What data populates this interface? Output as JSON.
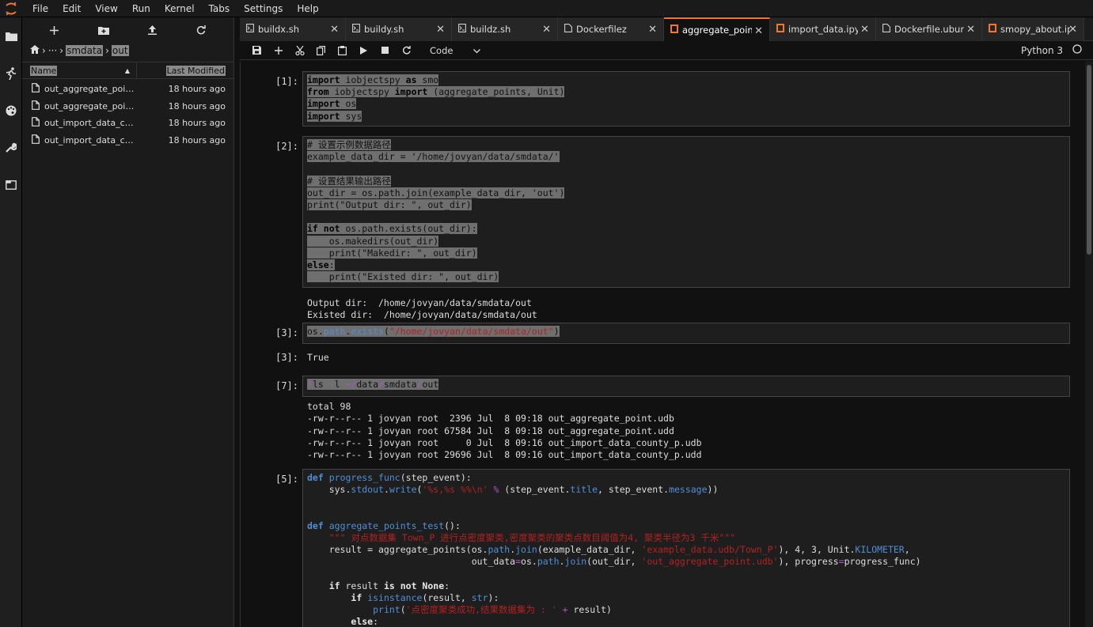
{
  "menubar": {
    "items": [
      "File",
      "Edit",
      "View",
      "Run",
      "Kernel",
      "Tabs",
      "Settings",
      "Help"
    ]
  },
  "filebrowser": {
    "breadcrumb": {
      "root_icon": "home-icon",
      "ellipsis": "···",
      "dir1": "smdata",
      "dir2": "out"
    },
    "columns": {
      "name": "Name",
      "modified": "Last Modified"
    },
    "files": [
      {
        "name": "out_aggregate_point.udb",
        "modified": "18 hours ago"
      },
      {
        "name": "out_aggregate_point.udd",
        "modified": "18 hours ago"
      },
      {
        "name": "out_import_data_county_p.udb",
        "modified": "18 hours ago"
      },
      {
        "name": "out_import_data_county_p.udd",
        "modified": "18 hours ago"
      }
    ]
  },
  "tabs": [
    {
      "label": "buildx.sh",
      "icon": "file-icon",
      "active": false
    },
    {
      "label": "buildy.sh",
      "icon": "file-icon",
      "active": false
    },
    {
      "label": "buildz.sh",
      "icon": "file-icon",
      "active": false
    },
    {
      "label": "Dockerfilez",
      "icon": "file-icon",
      "active": false
    },
    {
      "label": "aggregate_points",
      "icon": "notebook-icon",
      "active": true
    },
    {
      "label": "import_data.ipynb",
      "icon": "notebook-icon",
      "active": false
    },
    {
      "label": "Dockerfile.ubuntu",
      "icon": "file-icon",
      "active": false
    },
    {
      "label": "smopy_about.ipy",
      "icon": "notebook-icon",
      "active": false
    }
  ],
  "toolbar": {
    "cell_type": "Code",
    "kernel": "Python 3"
  },
  "cells": {
    "c1": {
      "prompt": "[1]:"
    },
    "c2": {
      "prompt": "[2]:",
      "out_prompt": "",
      "output": "Output dir:  /home/jovyan/data/smdata/out\nExisted dir:  /home/jovyan/data/smdata/out"
    },
    "c3": {
      "prompt": "[3]:",
      "out_prompt": "[3]:",
      "output": "True"
    },
    "c7": {
      "prompt": "[7]:",
      "output": "total 98\n-rw-r--r-- 1 jovyan root  2396 Jul  8 09:18 out_aggregate_point.udb\n-rw-r--r-- 1 jovyan root 67584 Jul  8 09:18 out_aggregate_point.udd\n-rw-r--r-- 1 jovyan root     0 Jul  8 09:16 out_import_data_county_p.udb\n-rw-r--r-- 1 jovyan root 29696 Jul  8 09:16 out_import_data_county_p.udd"
    },
    "c5": {
      "prompt": "[5]:"
    }
  }
}
